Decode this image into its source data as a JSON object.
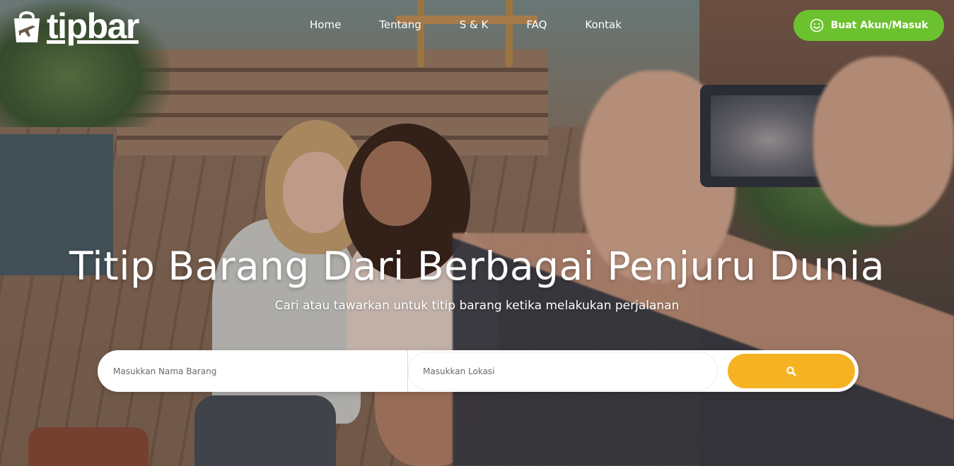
{
  "brand": {
    "name": "tipbar"
  },
  "nav": {
    "items": [
      {
        "label": "Home"
      },
      {
        "label": "Tentang"
      },
      {
        "label": "S & K"
      },
      {
        "label": "FAQ"
      },
      {
        "label": "Kontak"
      }
    ]
  },
  "cta": {
    "label": "Buat Akun/Masuk",
    "icon": "smiley-icon",
    "color": "#6cc12e"
  },
  "hero": {
    "title": "Titip Barang Dari Berbagai Penjuru Dunia",
    "subtitle": "Cari atau tawarkan untuk titip barang ketika melakukan perjalanan"
  },
  "search": {
    "item_placeholder": "Masukkan Nama Barang",
    "location_placeholder": "Masukkan Lokasi",
    "button_icon": "search-icon",
    "button_color": "#f5b324"
  }
}
